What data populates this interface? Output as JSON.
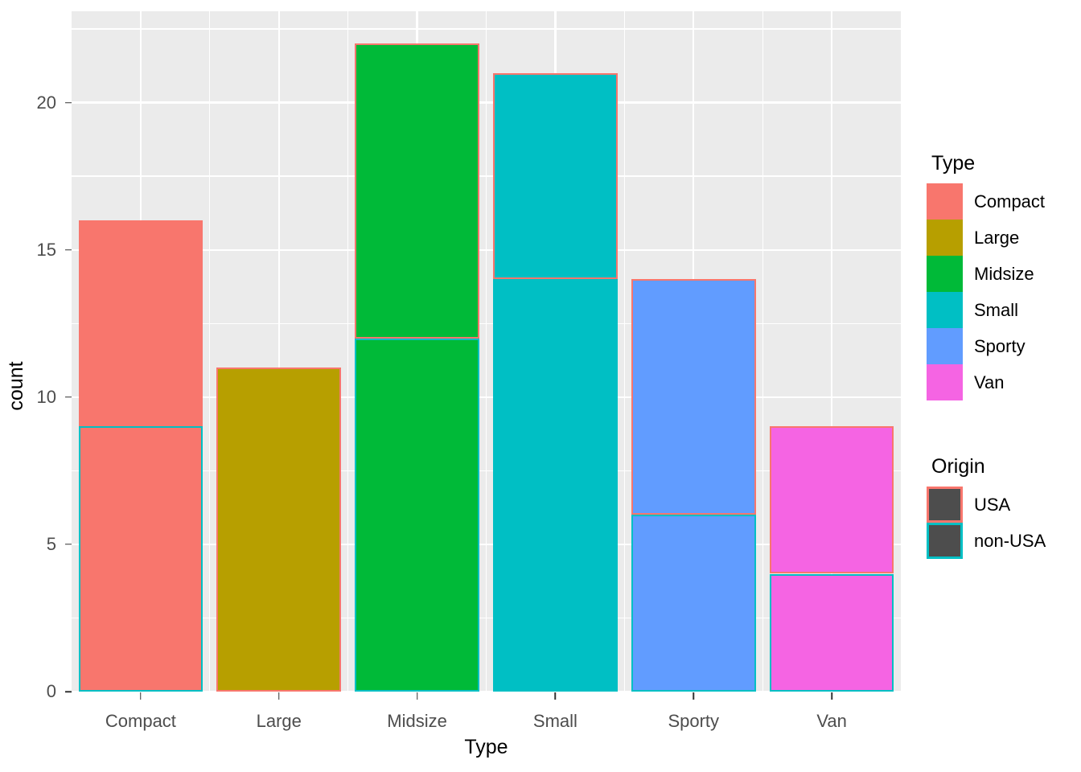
{
  "chart_data": {
    "type": "bar",
    "subtype": "stacked-bar",
    "title": "",
    "xlabel": "Type",
    "ylabel": "count",
    "categories": [
      "Compact",
      "Large",
      "Midsize",
      "Small",
      "Sporty",
      "Van"
    ],
    "series": [
      {
        "name": "non-USA",
        "values": [
          9,
          0,
          12,
          14,
          6,
          4
        ]
      },
      {
        "name": "USA",
        "values": [
          7,
          11,
          10,
          7,
          8,
          5
        ]
      }
    ],
    "totals": [
      16,
      11,
      22,
      21,
      14,
      9
    ],
    "stack_order_bottom_to_top": [
      "non-USA",
      "USA"
    ],
    "ylim": [
      0,
      23.1
    ],
    "y_ticks": [
      0,
      5,
      10,
      15,
      20
    ],
    "y_tick_labels": [
      "0",
      "5",
      "10",
      "15",
      "20"
    ],
    "y_minor_ticks": [
      2.5,
      7.5,
      12.5,
      17.5,
      22.5
    ],
    "x_tick_labels": [
      "Compact",
      "Large",
      "Midsize",
      "Small",
      "Sporty",
      "Van"
    ],
    "grid": true,
    "legend_position": "right",
    "fill_mapping": "Type",
    "color_mapping": "Origin",
    "fill_colors": {
      "Compact": "#F8766D",
      "Large": "#B79F00",
      "Midsize": "#00BA38",
      "Small": "#00BFC4",
      "Sporty": "#619CFF",
      "Van": "#F564E3"
    },
    "outline_colors": {
      "USA": "#F8766D",
      "non-USA": "#00BFC4"
    },
    "panel_background": "#EBEBEB",
    "gridline_color": "#FFFFFF",
    "bars": [
      {
        "category": "Compact",
        "fill": "#F8766D",
        "segments": [
          {
            "origin": "non-USA",
            "from": 0,
            "to": 9,
            "outline": "#00BFC4"
          },
          {
            "origin": "USA",
            "from": 9,
            "to": 16,
            "outline": "#F8766D"
          }
        ]
      },
      {
        "category": "Large",
        "fill": "#B79F00",
        "segments": [
          {
            "origin": "USA",
            "from": 0,
            "to": 11,
            "outline": "#F8766D"
          }
        ]
      },
      {
        "category": "Midsize",
        "fill": "#00BA38",
        "segments": [
          {
            "origin": "non-USA",
            "from": 0,
            "to": 12,
            "outline": "#00BFC4"
          },
          {
            "origin": "USA",
            "from": 12,
            "to": 22,
            "outline": "#F8766D"
          }
        ]
      },
      {
        "category": "Small",
        "fill": "#00BFC4",
        "segments": [
          {
            "origin": "non-USA",
            "from": 0,
            "to": 14,
            "outline": "#00BFC4"
          },
          {
            "origin": "USA",
            "from": 14,
            "to": 21,
            "outline": "#F8766D"
          }
        ]
      },
      {
        "category": "Sporty",
        "fill": "#619CFF",
        "segments": [
          {
            "origin": "non-USA",
            "from": 0,
            "to": 6,
            "outline": "#00BFC4"
          },
          {
            "origin": "USA",
            "from": 6,
            "to": 14,
            "outline": "#F8766D"
          }
        ]
      },
      {
        "category": "Van",
        "fill": "#F564E3",
        "segments": [
          {
            "origin": "non-USA",
            "from": 0,
            "to": 4,
            "outline": "#00BFC4"
          },
          {
            "origin": "USA",
            "from": 4,
            "to": 9,
            "outline": "#F8766D"
          }
        ]
      }
    ]
  },
  "axes": {
    "y_title": "count",
    "x_title": "Type"
  },
  "legends": [
    {
      "title": "Type",
      "kind": "fill",
      "items": [
        {
          "label": "Compact",
          "color": "#F8766D"
        },
        {
          "label": "Large",
          "color": "#B79F00"
        },
        {
          "label": "Midsize",
          "color": "#00BA38"
        },
        {
          "label": "Small",
          "color": "#00BFC4"
        },
        {
          "label": "Sporty",
          "color": "#619CFF"
        },
        {
          "label": "Van",
          "color": "#F564E3"
        }
      ]
    },
    {
      "title": "Origin",
      "kind": "outline",
      "items": [
        {
          "label": "USA",
          "color": "#F8766D",
          "fill": "#4D4D4D"
        },
        {
          "label": "non-USA",
          "color": "#00BFC4",
          "fill": "#4D4D4D"
        }
      ]
    }
  ]
}
